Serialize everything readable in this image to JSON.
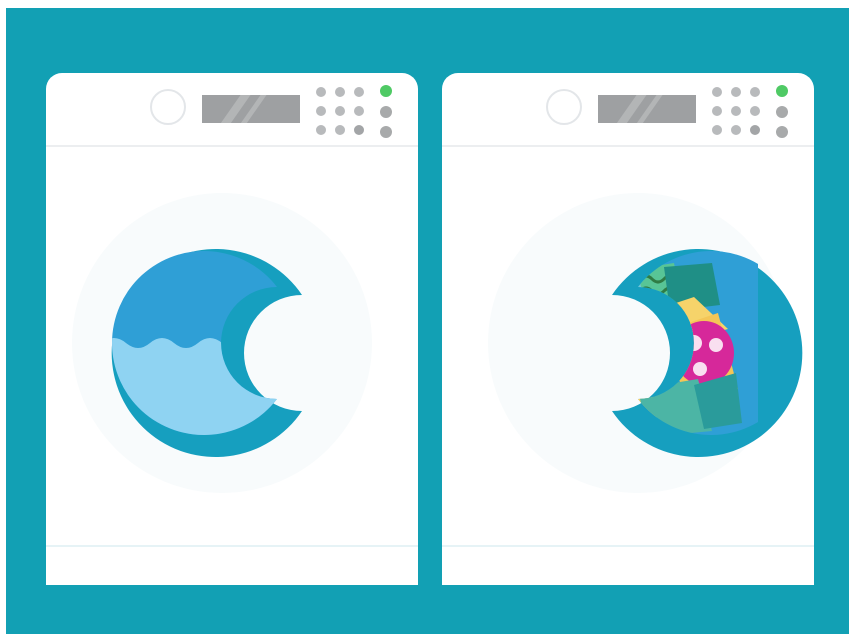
{
  "colors": {
    "background_teal": "#12a0b4",
    "machine_body": "#ffffff",
    "door_ring": "#169fbf",
    "drum_blue": "#2f9fd6",
    "water": "#8fd3f2",
    "indicator_green": "#4fca65",
    "indicator_gray": "#a8aaab"
  },
  "machines": [
    {
      "role": "left-washer",
      "drum_contents": "water",
      "indicator_lights": [
        "green",
        "gray",
        "gray"
      ]
    },
    {
      "role": "right-washer",
      "drum_contents": "laundry",
      "indicator_lights": [
        "green",
        "gray",
        "gray"
      ]
    }
  ],
  "icons": [
    "knob-icon",
    "display-icon",
    "button-grid-icon",
    "indicator-light-icon",
    "door-icon",
    "water-icon",
    "laundry-icon"
  ]
}
